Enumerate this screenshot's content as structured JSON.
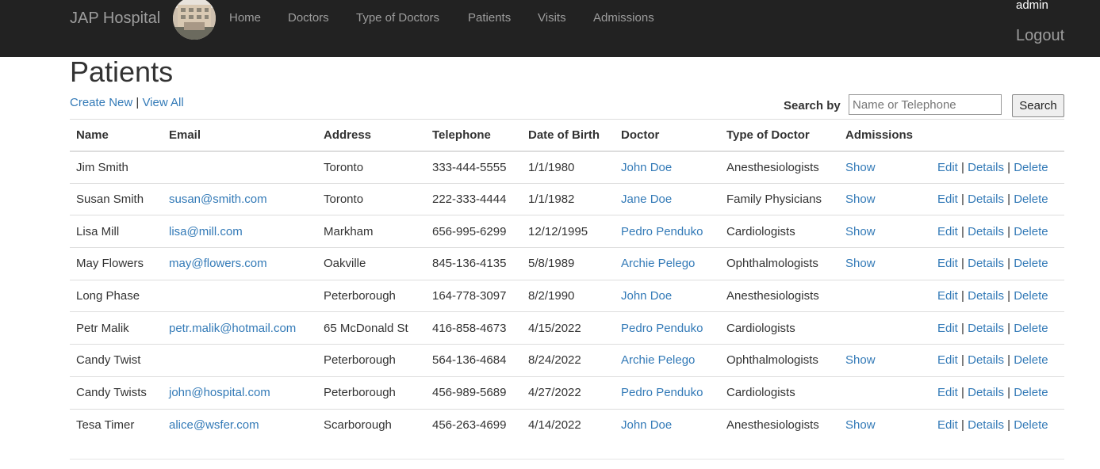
{
  "navbar": {
    "brand": "JAP Hospital",
    "logo_icon": "hospital-building-photo",
    "items": [
      "Home",
      "Doctors",
      "Type of Doctors",
      "Patients",
      "Visits",
      "Admissions"
    ],
    "user": "admin",
    "logout": "Logout"
  },
  "page": {
    "title": "Patients",
    "create_new": "Create New",
    "separator": "|",
    "view_all": "View All"
  },
  "search": {
    "label": "Search by",
    "placeholder": "Name or Telephone",
    "value": "",
    "button": "Search"
  },
  "table": {
    "headers": [
      "Name",
      "Email",
      "Address",
      "Telephone",
      "Date of Birth",
      "Doctor",
      "Type of Doctor",
      "Admissions",
      ""
    ],
    "action_edit": "Edit",
    "action_details": "Details",
    "action_delete": "Delete",
    "action_sep": "|",
    "rows": [
      {
        "name": "Jim Smith",
        "email": "",
        "address": "Toronto",
        "telephone": "333-444-5555",
        "dob": "1/1/1980",
        "doctor": "John Doe",
        "type": "Anesthesiologists",
        "admissions": "Show"
      },
      {
        "name": "Susan Smith",
        "email": "susan@smith.com",
        "address": "Toronto",
        "telephone": "222-333-4444",
        "dob": "1/1/1982",
        "doctor": "Jane Doe",
        "type": "Family Physicians",
        "admissions": "Show"
      },
      {
        "name": "Lisa Mill",
        "email": "lisa@mill.com",
        "address": "Markham",
        "telephone": "656-995-6299",
        "dob": "12/12/1995",
        "doctor": "Pedro Penduko",
        "type": "Cardiologists",
        "admissions": "Show"
      },
      {
        "name": "May Flowers",
        "email": "may@flowers.com",
        "address": "Oakville",
        "telephone": "845-136-4135",
        "dob": "5/8/1989",
        "doctor": "Archie Pelego",
        "type": "Ophthalmologists",
        "admissions": "Show"
      },
      {
        "name": "Long Phase",
        "email": "",
        "address": "Peterborough",
        "telephone": "164-778-3097",
        "dob": "8/2/1990",
        "doctor": "John Doe",
        "type": "Anesthesiologists",
        "admissions": ""
      },
      {
        "name": "Petr Malik",
        "email": "petr.malik@hotmail.com",
        "address": "65 McDonald St",
        "telephone": "416-858-4673",
        "dob": "4/15/2022",
        "doctor": "Pedro Penduko",
        "type": "Cardiologists",
        "admissions": ""
      },
      {
        "name": "Candy Twist",
        "email": "",
        "address": "Peterborough",
        "telephone": "564-136-4684",
        "dob": "8/24/2022",
        "doctor": "Archie Pelego",
        "type": "Ophthalmologists",
        "admissions": "Show"
      },
      {
        "name": "Candy Twists",
        "email": "john@hospital.com",
        "address": "Peterborough",
        "telephone": "456-989-5689",
        "dob": "4/27/2022",
        "doctor": "Pedro Penduko",
        "type": "Cardiologists",
        "admissions": ""
      },
      {
        "name": "Tesa Timer",
        "email": "alice@wsfer.com",
        "address": "Scarborough",
        "telephone": "456-263-4699",
        "dob": "4/14/2022",
        "doctor": "John Doe",
        "type": "Anesthesiologists",
        "admissions": "Show"
      }
    ]
  }
}
